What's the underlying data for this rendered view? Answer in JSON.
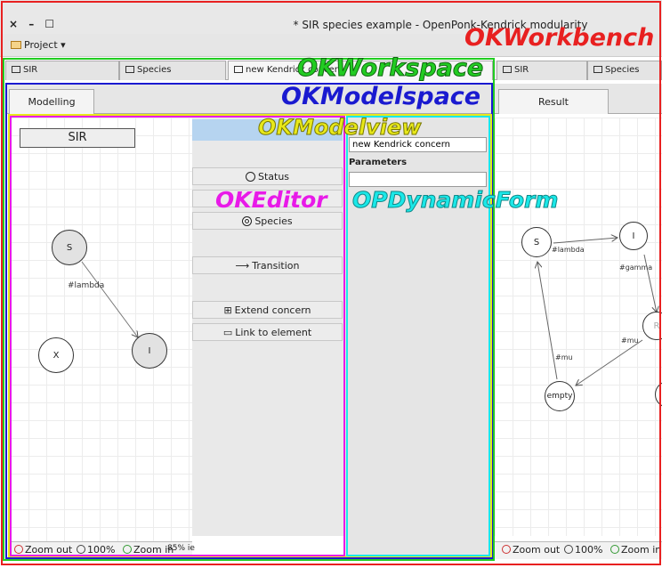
{
  "window": {
    "controls": "× – ☐",
    "title": "* SIR species example - OpenPonk-Kendrick modularity"
  },
  "toolbar": {
    "project_menu": "Project ▾"
  },
  "left_tabs": [
    {
      "label": "SIR"
    },
    {
      "label": "Species"
    },
    {
      "label": "new Kendrick concern"
    }
  ],
  "right_tabs": [
    {
      "label": "SIR"
    },
    {
      "label": "Species"
    }
  ],
  "left_subtab": "Modelling",
  "right_subtab": "Result",
  "model": {
    "title_box": "SIR",
    "nodes": {
      "s": "S",
      "i": "I",
      "x": "X"
    },
    "edge_label": "#lambda"
  },
  "palette": {
    "status": "Status",
    "species": "Species",
    "transition": "Transition",
    "extend_concern": "Extend concern",
    "link_to_element": "Link to element"
  },
  "form": {
    "name_value": "new Kendrick concern",
    "parameters_label": "Parameters",
    "parameters_value": ""
  },
  "result": {
    "nodes": {
      "s": "S",
      "i": "I",
      "r": "R",
      "empty": "empty"
    },
    "edge_labels": {
      "lambda": "#lambda",
      "gamma": "#gamma",
      "mu1": "#mu",
      "mu2": "#mu"
    }
  },
  "zoom_left": {
    "out": "Zoom out",
    "pct": "100%",
    "in": "Zoom in",
    "extra": "85% ie"
  },
  "zoom_right": {
    "out": "Zoom out",
    "pct": "100%",
    "in": "Zoom in"
  },
  "annotations": {
    "workbench": "OKWorkbench",
    "workspace": "OKWorkspace",
    "modelspace": "OKModelspace",
    "modelview": "OKModelview",
    "editor": "OKEditor",
    "dynamicform": "OPDynamicForm"
  },
  "colors": {
    "workbench": "#e82020",
    "workspace": "#22cc22",
    "modelspace": "#1a1ad0",
    "modelview": "#e8e81a",
    "editor": "#e81ae8",
    "dynamicform": "#1ae8e8"
  }
}
